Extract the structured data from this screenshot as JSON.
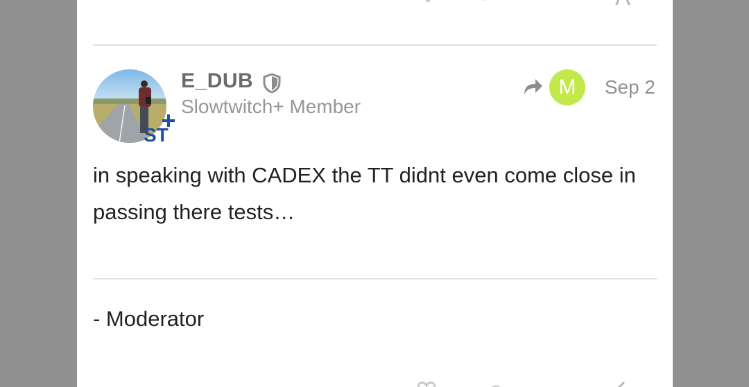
{
  "post": {
    "author": {
      "username": "E_DUB",
      "title": "Slowtwitch+ Member",
      "badge_text": "ST+"
    },
    "reply_to": {
      "avatar_letter": "M",
      "avatar_color": "#c2e84b"
    },
    "date": "Sep 2",
    "body": "in speaking with CADEX the TT didnt even come close in passing there tests…",
    "signature": "- Moderator"
  },
  "icons": {
    "moderator": "shield-icon",
    "reply": "share-arrow-icon",
    "like": "heart-icon",
    "link": "link-icon",
    "share": "share-icon"
  },
  "colors": {
    "page_background": "#919191",
    "card_background": "#ffffff",
    "username": "#6b6b6b",
    "meta_text": "#919191",
    "body_text": "#222222",
    "divider": "#e2e2e2"
  }
}
